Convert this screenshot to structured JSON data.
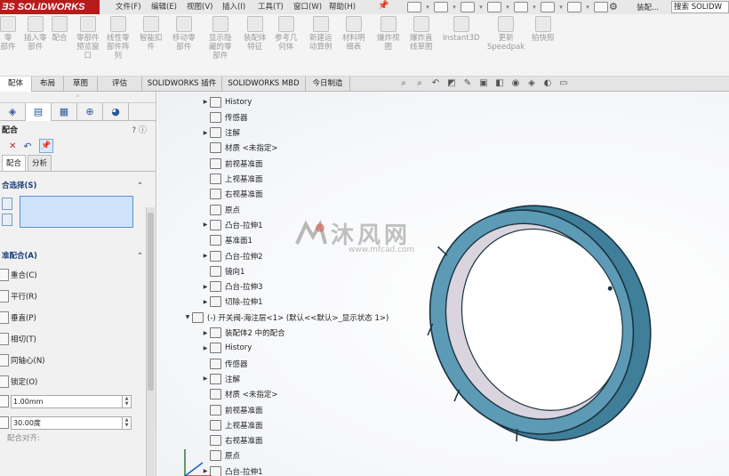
{
  "app": {
    "logo_text": "SOLIDWORKS",
    "asm_label": "装配...",
    "search_placeholder": "搜索 SOLIDW"
  },
  "menu": [
    "文件(F)",
    "编辑(E)",
    "视图(V)",
    "插入(I)",
    "工具(T)",
    "窗口(W)",
    "帮助(H)"
  ],
  "ribbon": [
    {
      "label": "零\n部件"
    },
    {
      "label": "插入零\n部件"
    },
    {
      "label": "配合"
    },
    {
      "label": "零部件\n预览窗\n口"
    },
    {
      "label": "线性零\n部件阵\n列"
    },
    {
      "label": "智能扣\n件"
    },
    {
      "label": "移动零\n部件"
    },
    {
      "label": "显示隐\n藏的零\n部件"
    },
    {
      "label": "装配体\n特征"
    },
    {
      "label": "参考几\n何体"
    },
    {
      "label": "新建运\n动算例"
    },
    {
      "label": "材料明\n细表"
    },
    {
      "label": "爆炸视\n图"
    },
    {
      "label": "爆炸直\n线草图"
    },
    {
      "label": "Instant3D"
    },
    {
      "label": "更新\nSpeedpak"
    },
    {
      "label": "拍快照"
    }
  ],
  "tabs": [
    "配体",
    "布局",
    "草图",
    "评估",
    "SOLIDWORKS 插件",
    "SOLIDWORKS MBD",
    "今日制造"
  ],
  "pm": {
    "title": "配合",
    "help": "? ⓘ",
    "subtabs": [
      "配合",
      "分析"
    ],
    "section_selection": "合选择(S)",
    "section_standard": "准配合(A)",
    "options": [
      "重合(C)",
      "平行(R)",
      "垂直(P)",
      "相切(T)",
      "同轴心(N)",
      "锁定(O)"
    ],
    "distance_value": "1.00mm",
    "angle_value": "30.00度",
    "align_label": "配合对齐:"
  },
  "tree": [
    {
      "label": "History",
      "exp": true
    },
    {
      "label": "传感器",
      "exp": false
    },
    {
      "label": "注解",
      "exp": true
    },
    {
      "label": "材质 <未指定>",
      "exp": false
    },
    {
      "label": "前视基准面",
      "exp": false
    },
    {
      "label": "上视基准面",
      "exp": false
    },
    {
      "label": "右视基准面",
      "exp": false
    },
    {
      "label": "原点",
      "exp": false
    },
    {
      "label": "凸台-拉伸1",
      "exp": true
    },
    {
      "label": "基准面1",
      "exp": false
    },
    {
      "label": "凸台-拉伸2",
      "exp": true
    },
    {
      "label": "镜向1",
      "exp": false
    },
    {
      "label": "凸台-拉伸3",
      "exp": true
    },
    {
      "label": "切除-拉伸1",
      "exp": true
    },
    {
      "label": "(-) 开关阀-海注层<1> (默认<<默认>_显示状态 1>)",
      "exp": true
    },
    {
      "label": "装配体2 中的配合",
      "exp": true
    },
    {
      "label": "History",
      "exp": true
    },
    {
      "label": "传感器",
      "exp": false
    },
    {
      "label": "注解",
      "exp": true
    },
    {
      "label": "材质 <未指定>",
      "exp": false
    },
    {
      "label": "前视基准面",
      "exp": false
    },
    {
      "label": "上视基准面",
      "exp": false
    },
    {
      "label": "右视基准面",
      "exp": false
    },
    {
      "label": "原点",
      "exp": false
    },
    {
      "label": "凸台-拉伸1",
      "exp": true
    }
  ],
  "watermark": {
    "main": "沐风网",
    "url": "www.mfcad.com"
  },
  "colors": {
    "logo_bg": "#b71c1c",
    "ring_outer": "#4a8aa6",
    "ring_inner": "#d8d3dc",
    "selection": "#cfe3fb"
  }
}
